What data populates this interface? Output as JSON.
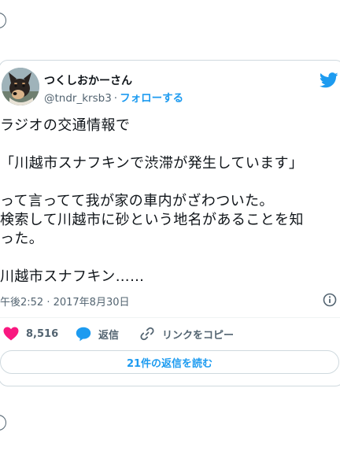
{
  "tweet": {
    "author": {
      "display_name": "つくしおかーさん",
      "handle": "@tndr_krsb3",
      "separator": "·",
      "follow_label": "フォローする"
    },
    "text_lines": [
      "ラジオの交通情報で",
      "「川越市スナフキンで渋滞が発生しています」",
      "って言ってて我が家の車内がざわついた。",
      "検索して川越市に砂という地名があることを知",
      "った。",
      "川越市スナフキン……"
    ],
    "timestamp": "午後2:52 · 2017年8月30日",
    "actions": {
      "like_count": "8,516",
      "reply_label": "返信",
      "copy_link_label": "リンクをコピー"
    },
    "read_replies_label": "21件の返信を読む"
  },
  "colors": {
    "accent": "#1d9bf0",
    "like": "#f91880",
    "text": "#0f1419",
    "secondary": "#536471",
    "border": "#cfd9de"
  },
  "icons": [
    "twitter-bird-icon",
    "info-icon",
    "heart-icon",
    "reply-bubble-icon",
    "link-icon"
  ]
}
